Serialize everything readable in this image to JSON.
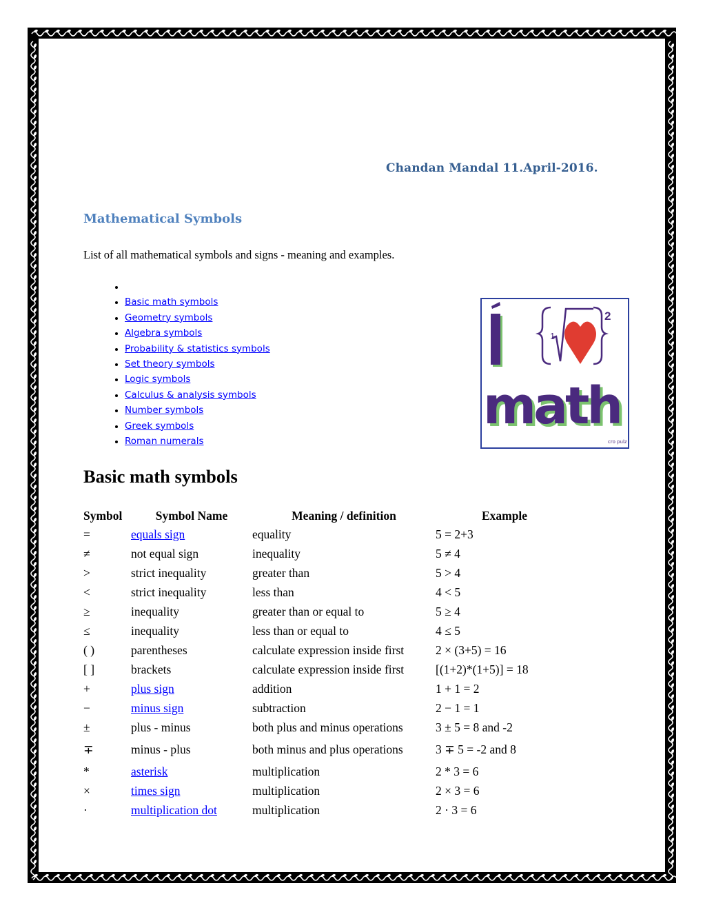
{
  "document": {
    "author_line": "Chandan Mandal 11.April-2016.",
    "section_title": "Mathematical Symbols",
    "intro": "List of all mathematical symbols and signs - meaning and examples.",
    "toc": [
      {
        "label": "",
        "link": false
      },
      {
        "label": "Basic math symbols",
        "link": true
      },
      {
        "label": "Geometry symbols",
        "link": true
      },
      {
        "label": "Algebra symbols",
        "link": true
      },
      {
        "label": "Probability & statistics symbols",
        "link": true
      },
      {
        "label": "Set theory symbols",
        "link": true
      },
      {
        "label": "Logic symbols",
        "link": true
      },
      {
        "label": "Calculus & analysis symbols",
        "link": true
      },
      {
        "label": "Number symbols",
        "link": true
      },
      {
        "label": "Greek symbols",
        "link": true
      },
      {
        "label": "Roman numerals",
        "link": true
      }
    ],
    "logo": {
      "icon": "i-love-math-image",
      "text_i": "i",
      "text_math": "math",
      "exponent": "2",
      "credit": "cro pulz",
      "colors": {
        "purple": "#4a2a7e",
        "green": "#7cc36f",
        "heart": "#e03c31",
        "border": "#2b3f9e"
      }
    },
    "basic_heading": "Basic math symbols",
    "table": {
      "headers": [
        "Symbol",
        "Symbol Name",
        "Meaning / definition",
        "Example"
      ],
      "rows": [
        {
          "symbol": "=",
          "name": "equals sign",
          "link": true,
          "meaning": "equality",
          "example": "5 = 2+3"
        },
        {
          "symbol": "≠",
          "name": "not equal sign",
          "link": false,
          "meaning": "inequality",
          "example": "5 ≠ 4"
        },
        {
          "symbol": ">",
          "name": "strict inequality",
          "link": false,
          "meaning": "greater than",
          "example": "5 > 4"
        },
        {
          "symbol": "<",
          "name": "strict inequality",
          "link": false,
          "meaning": "less than",
          "example": "4 < 5"
        },
        {
          "symbol": "≥",
          "name": "inequality",
          "link": false,
          "meaning": "greater than or equal to",
          "example": "5 ≥ 4"
        },
        {
          "symbol": "≤",
          "name": "inequality",
          "link": false,
          "meaning": "less than or equal to",
          "example": "4 ≤ 5"
        },
        {
          "symbol": "( )",
          "name": "parentheses",
          "link": false,
          "meaning": "calculate expression inside first",
          "example": "2 × (3+5) = 16"
        },
        {
          "symbol": "[ ]",
          "name": "brackets",
          "link": false,
          "meaning": "calculate expression inside first",
          "example": "[(1+2)*(1+5)] = 18"
        },
        {
          "symbol": "+",
          "name": "plus sign",
          "link": true,
          "meaning": "addition",
          "example": "1 + 1 = 2"
        },
        {
          "symbol": "−",
          "name": "minus sign",
          "link": true,
          "meaning": "subtraction",
          "example": "2 − 1 = 1"
        },
        {
          "symbol": "±",
          "name": "plus - minus",
          "link": false,
          "meaning": "both plus and minus operations",
          "example": "3 ± 5 = 8 and -2"
        },
        {
          "symbol": "∓",
          "name": "minus - plus",
          "link": false,
          "meaning": "both minus and plus operations",
          "example": "3 ∓ 5 = -2 and 8"
        },
        {
          "symbol": "*",
          "name": "asterisk",
          "link": true,
          "meaning": "multiplication",
          "example": "2 * 3 = 6"
        },
        {
          "symbol": "×",
          "name": "times sign",
          "link": true,
          "meaning": "multiplication",
          "example": "2 × 3 = 6"
        },
        {
          "symbol": "·",
          "name": "multiplication dot",
          "link": true,
          "meaning": "multiplication",
          "example": "2 · 3 = 6"
        }
      ]
    },
    "colors": {
      "heading_blue": "#365f91",
      "section_blue": "#4f81bd",
      "link_blue": "#0000ff",
      "frame": "#000000"
    }
  }
}
